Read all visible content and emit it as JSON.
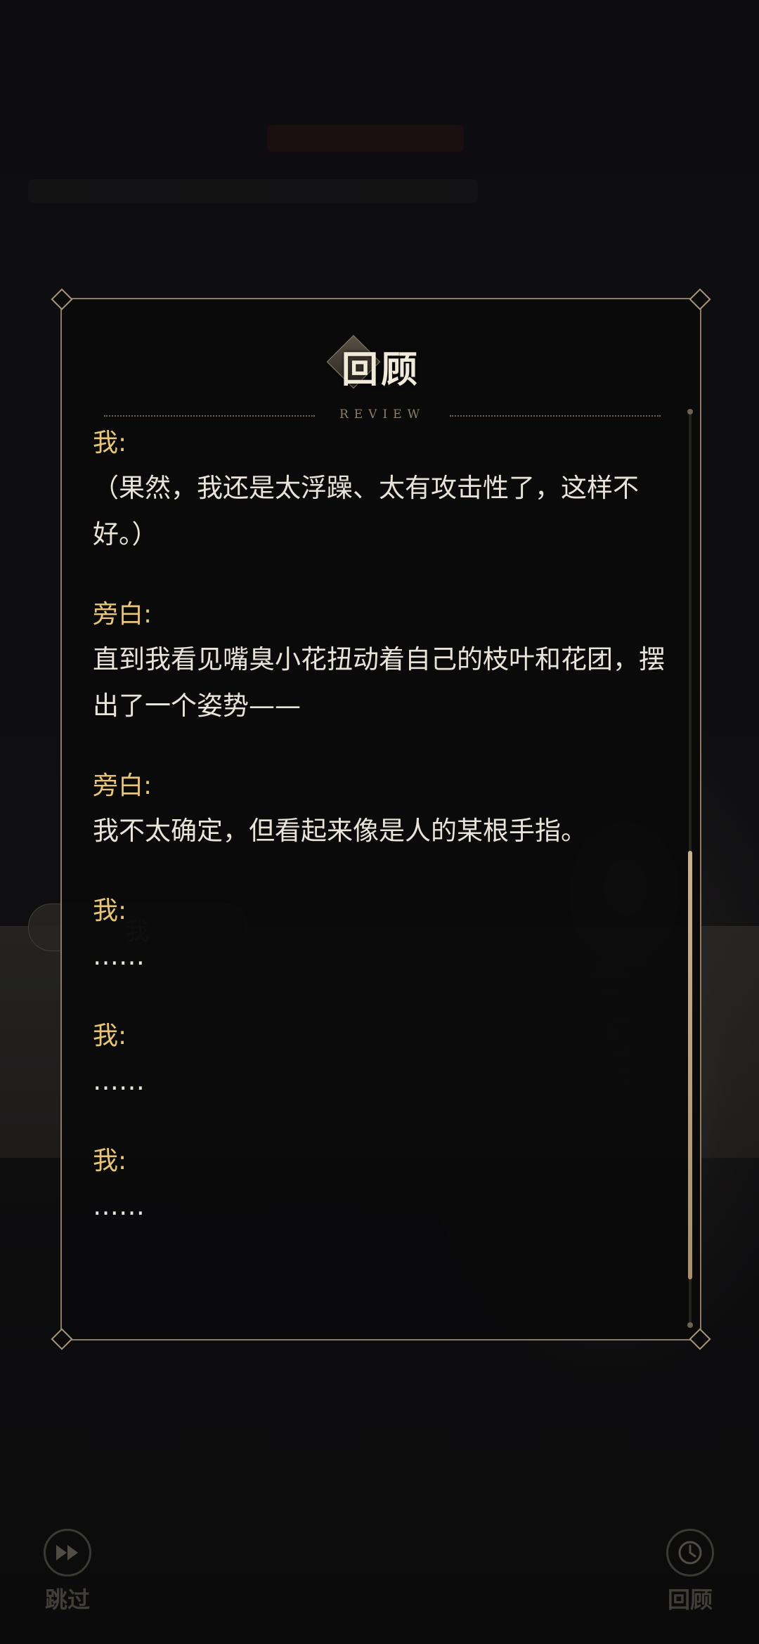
{
  "background": {
    "name_plate": "我"
  },
  "panel": {
    "title": "回顾",
    "subtitle": "REVIEW"
  },
  "entries": [
    {
      "speaker": "我:",
      "text": "（果然，我还是太浮躁、太有攻击性了，这样不好。）"
    },
    {
      "speaker": "旁白:",
      "text": "直到我看见嘴臭小花扭动着自己的枝叶和花团，摆出了一个姿势——"
    },
    {
      "speaker": "旁白:",
      "text": "我不太确定，但看起来像是人的某根手指。"
    },
    {
      "speaker": "我:",
      "text": "……"
    },
    {
      "speaker": "我:",
      "text": "……"
    },
    {
      "speaker": "我:",
      "text": "……"
    }
  ],
  "controls": {
    "skip_label": "跳过",
    "skip_icon": "fast-forward-icon",
    "review_label": "回顾",
    "review_icon": "clock-icon"
  },
  "colors": {
    "speaker": "#e7c679",
    "text": "#e9e4da",
    "frame": "#8b7b66"
  }
}
